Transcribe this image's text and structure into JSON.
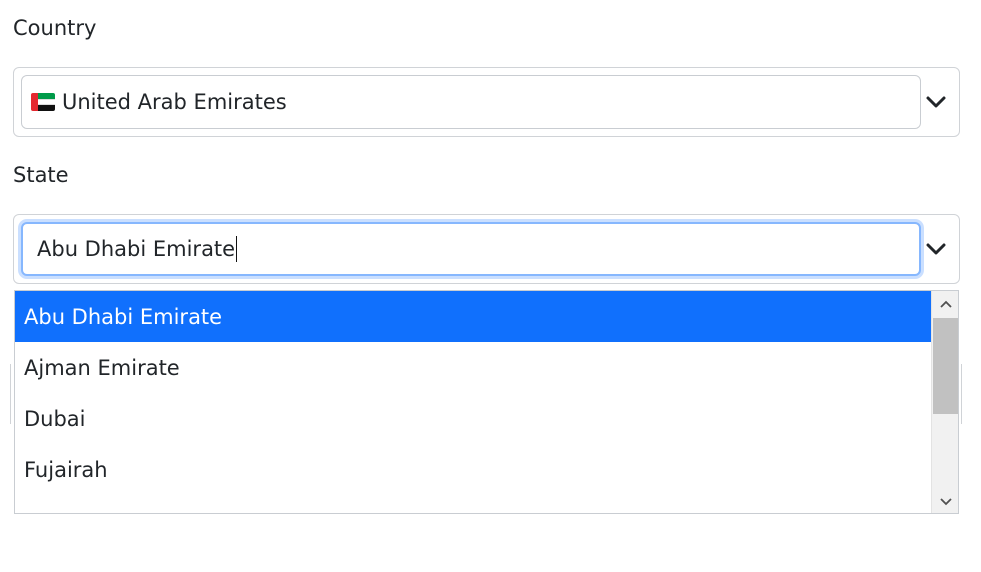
{
  "country": {
    "label": "Country",
    "selected_value": "United Arab Emirates",
    "flag_icon": "uae-flag-icon",
    "flag_colors": [
      "#e4282f",
      "#009a49",
      "#ffffff",
      "#111111"
    ]
  },
  "state": {
    "label": "State",
    "input_value": "Abu Dhabi Emirate",
    "focus_color": "#86b7fe",
    "options": [
      {
        "label": "Abu Dhabi Emirate",
        "selected": true
      },
      {
        "label": "Ajman Emirate",
        "selected": false
      },
      {
        "label": "Dubai",
        "selected": false
      },
      {
        "label": "Fujairah",
        "selected": false
      }
    ],
    "highlight_color": "#1070fd"
  }
}
